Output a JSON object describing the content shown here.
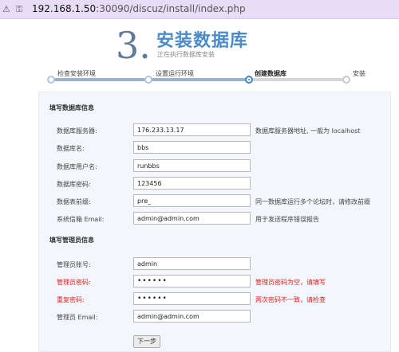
{
  "address_bar": {
    "url_host": "192.168.1.50",
    "url_rest": ":30090/discuz/install/index.php"
  },
  "header": {
    "step_number": "3.",
    "title": "安装数据库",
    "subtitle": "正在执行数据库安装"
  },
  "steps": [
    {
      "label": "检查安装环境",
      "state": "done"
    },
    {
      "label": "设置运行环境",
      "state": "done"
    },
    {
      "label": "创建数据库",
      "state": "active"
    },
    {
      "label": "安装",
      "state": "pending"
    }
  ],
  "db_section": {
    "title": "填写数据库信息",
    "fields": [
      {
        "label": "数据库服务器:",
        "value": "176.233.13.17",
        "hint": "数据库服务器地址, 一般为 localhost"
      },
      {
        "label": "数据库名:",
        "value": "bbs",
        "hint": ""
      },
      {
        "label": "数据库用户名:",
        "value": "runbbs",
        "hint": ""
      },
      {
        "label": "数据库密码:",
        "value": "123456",
        "hint": ""
      },
      {
        "label": "数据表前缀:",
        "value": "pre_",
        "hint": "同一数据库运行多个论坛时，请修改前缀"
      },
      {
        "label": "系统信箱 Email:",
        "value": "admin@admin.com",
        "hint": "用于发送程序错误报告"
      }
    ]
  },
  "admin_section": {
    "title": "填写管理员信息",
    "fields": [
      {
        "label": "管理员账号:",
        "value": "admin",
        "hint": "",
        "error": false
      },
      {
        "label": "管理员密码:",
        "value": "••••••",
        "hint": "管理员密码为空，请填写",
        "error": true
      },
      {
        "label": "重复密码:",
        "value": "••••••",
        "hint": "两次密码不一致，请检查",
        "error": true
      },
      {
        "label": "管理员 Email:",
        "value": "admin@admin.com",
        "hint": "",
        "error": false
      }
    ]
  },
  "next_button": "下一步",
  "colors": {
    "accent": "#4d8bc8",
    "error": "#e21c1c",
    "panel_bg": "#f3f7fb"
  }
}
